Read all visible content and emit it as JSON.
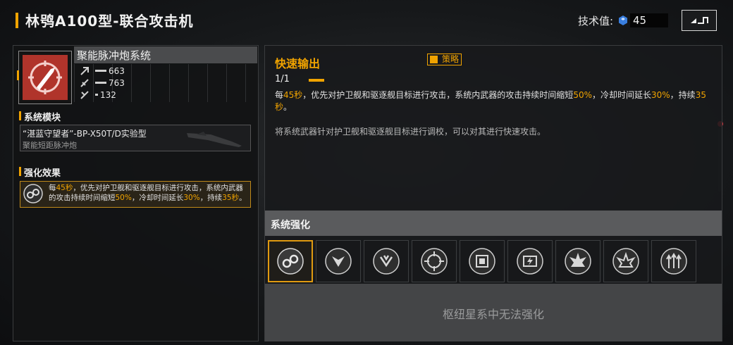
{
  "header": {
    "title": "林鸮A100型-联合攻击机",
    "tech_label": "技术值:",
    "tech_value": "45"
  },
  "module": {
    "name": "聚能脉冲炮系统",
    "stats": [
      {
        "icon": "damage-stat-icon",
        "value": "663"
      },
      {
        "icon": "armor-stat-icon",
        "value": "763"
      },
      {
        "icon": "speed-stat-icon",
        "value": "132"
      }
    ]
  },
  "system_module": {
    "section_title": "系统模块",
    "weapon_name": "“湛蓝守望者”-BP-X50T/D实验型",
    "weapon_type": "聚能短距脉冲炮"
  },
  "enhance_effect": {
    "section_title": "强化效果",
    "text_parts": [
      "每",
      "45秒",
      "，优先对护卫舰和驱逐舰目标进行攻击，系统内武器的攻击持续时间缩短",
      "50%",
      "，冷却时间延长",
      "30%",
      "，持续",
      "35秒",
      "。"
    ]
  },
  "skill": {
    "title": "快速输出",
    "tag": "策略",
    "level": "1/1",
    "desc_parts": [
      "每",
      "45秒",
      "，优先对护卫舰和驱逐舰目标进行攻击，系统内武器的攻击持续时间缩短",
      "50%",
      "，冷却时间延长",
      "30%",
      "，持续",
      "35秒",
      "。"
    ],
    "note": "将系统武器针对护卫舰和驱逐舰目标进行调校，可以对其进行快速攻击。"
  },
  "enhancement": {
    "title": "系统强化",
    "slots": [
      {
        "icon": "chain-link-icon",
        "selected": true
      },
      {
        "icon": "shield-arrow-icon",
        "selected": false
      },
      {
        "icon": "shield-arrow-down-icon",
        "selected": false
      },
      {
        "icon": "crosshair-icon",
        "selected": false
      },
      {
        "icon": "chip-icon",
        "selected": false
      },
      {
        "icon": "energy-cell-icon",
        "selected": false
      },
      {
        "icon": "burst-icon",
        "selected": false
      },
      {
        "icon": "burst-alt-icon",
        "selected": false
      },
      {
        "icon": "triple-arrow-icon",
        "selected": false
      }
    ],
    "locked_text": "枢纽星系中无法强化"
  },
  "colors": {
    "accent": "#f0a300",
    "module_icon_bg": "#b0342b"
  }
}
